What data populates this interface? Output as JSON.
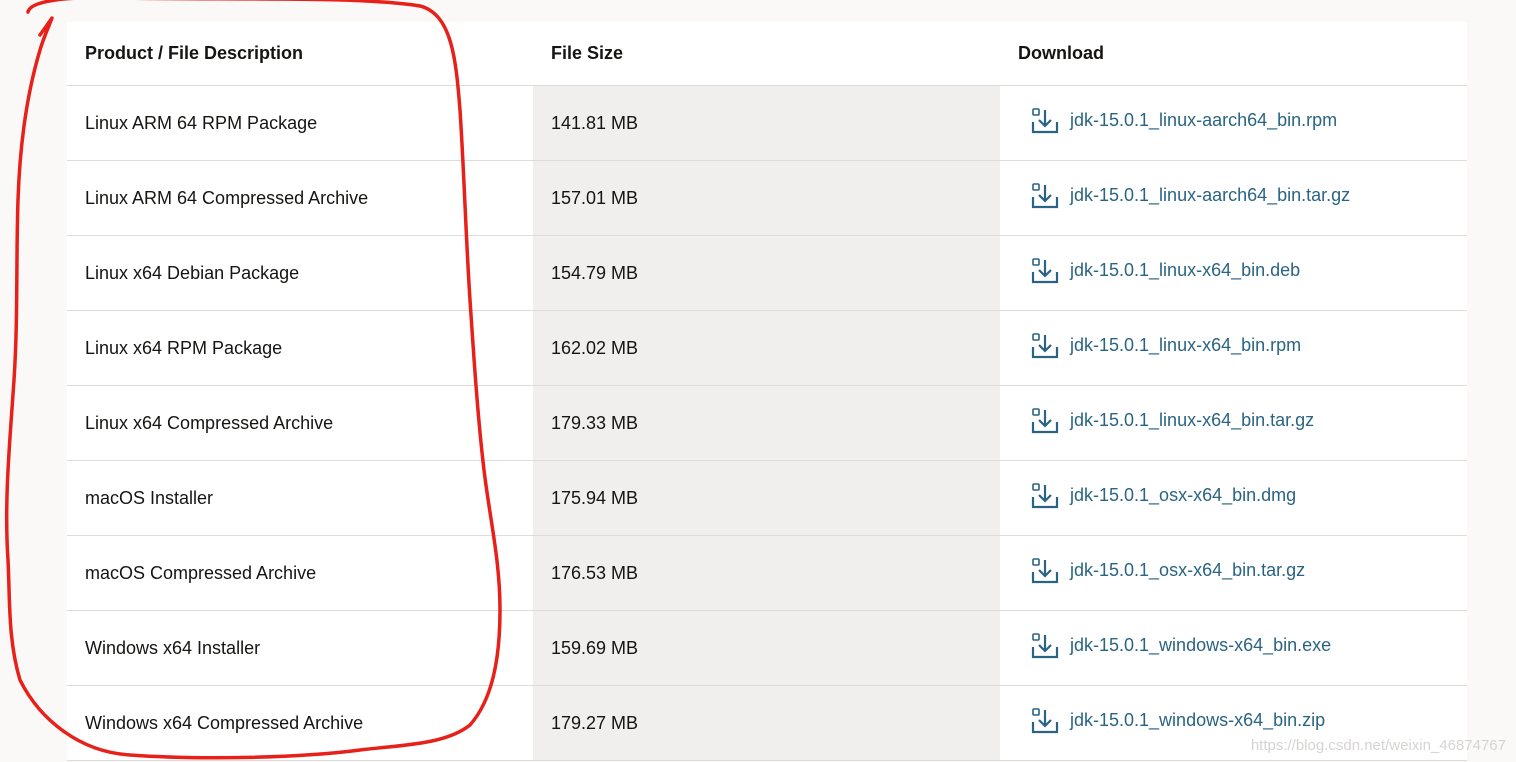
{
  "table": {
    "headers": {
      "product": "Product / File Description",
      "size": "File Size",
      "download": "Download"
    },
    "rows": [
      {
        "product": "Linux ARM 64 RPM Package",
        "size": "141.81 MB",
        "file": "jdk-15.0.1_linux-aarch64_bin.rpm"
      },
      {
        "product": "Linux ARM 64 Compressed Archive",
        "size": "157.01 MB",
        "file": "jdk-15.0.1_linux-aarch64_bin.tar.gz"
      },
      {
        "product": "Linux x64 Debian Package",
        "size": "154.79 MB",
        "file": "jdk-15.0.1_linux-x64_bin.deb"
      },
      {
        "product": "Linux x64 RPM Package",
        "size": "162.02 MB",
        "file": "jdk-15.0.1_linux-x64_bin.rpm"
      },
      {
        "product": "Linux x64 Compressed Archive",
        "size": "179.33 MB",
        "file": "jdk-15.0.1_linux-x64_bin.tar.gz"
      },
      {
        "product": "macOS Installer",
        "size": "175.94 MB",
        "file": "jdk-15.0.1_osx-x64_bin.dmg"
      },
      {
        "product": "macOS Compressed Archive",
        "size": "176.53 MB",
        "file": "jdk-15.0.1_osx-x64_bin.tar.gz"
      },
      {
        "product": "Windows x64 Installer",
        "size": "159.69 MB",
        "file": "jdk-15.0.1_windows-x64_bin.exe"
      },
      {
        "product": "Windows x64 Compressed Archive",
        "size": "179.27 MB",
        "file": "jdk-15.0.1_windows-x64_bin.zip"
      }
    ]
  },
  "watermark": "https://blog.csdn.net/weixin_46874767",
  "icons": {
    "download": "download-arrow-icon"
  },
  "colors": {
    "link": "#2a6484",
    "annotation": "#e8201a",
    "size_column_bg": "#f1efed"
  }
}
